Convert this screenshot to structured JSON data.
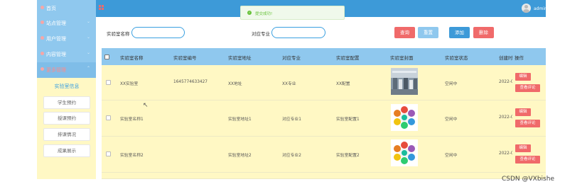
{
  "sidebar": {
    "menu": [
      {
        "label": "首页",
        "active": false
      },
      {
        "label": "站点管理",
        "active": false
      },
      {
        "label": "用户管理",
        "active": false
      },
      {
        "label": "内容管理",
        "active": false
      },
      {
        "label": "更多管理",
        "active": true
      }
    ],
    "submenu": [
      {
        "label": "实验室信息",
        "active": true
      },
      {
        "label": "学生预约",
        "active": false
      },
      {
        "label": "授课预约",
        "active": false
      },
      {
        "label": "排课情况",
        "active": false
      },
      {
        "label": "成果展示",
        "active": false
      }
    ]
  },
  "topbar": {
    "user": "admin"
  },
  "toast": {
    "text": "提交成功!"
  },
  "search": {
    "name_label": "实验室名称",
    "name_value": "",
    "major_label": "对应专业",
    "major_value": ""
  },
  "buttons": {
    "query": "查询",
    "reset": "重置",
    "add": "添加",
    "delete": "删除"
  },
  "table": {
    "headers": [
      "实验室名称",
      "实验室编号",
      "实验室地址",
      "对应专业",
      "实验室配置",
      "实验室封面",
      "实验室状态",
      "创建时",
      "操作"
    ],
    "rows": [
      {
        "name": "XX实验室",
        "code": "1645774633427",
        "address": "XX地址",
        "major": "XX专业",
        "config": "XX配置",
        "cover": "lab-photo",
        "status": "空闲中",
        "created": "2022-0"
      },
      {
        "name": "实验室名称1",
        "code": "",
        "address": "实验室地址1",
        "major": "对应专业1",
        "config": "实验室配置1",
        "cover": "colorful-diagram",
        "status": "空闲中",
        "created": "2022-0"
      },
      {
        "name": "实验室名称2",
        "code": "",
        "address": "实验室地址2",
        "major": "对应专业2",
        "config": "实验室配置2",
        "cover": "colorful-diagram",
        "status": "空闲中",
        "created": "2022-0"
      }
    ],
    "action_edit": "编辑",
    "action_review": "查看评论"
  },
  "watermark": "CSDN @VXbishe",
  "colors": {
    "topbar": "#3d9ad8",
    "sidebar": "#8fc8ee",
    "row_bg": "#fff8c4",
    "danger": "#f06a6a",
    "primary": "#3aa0e0"
  }
}
